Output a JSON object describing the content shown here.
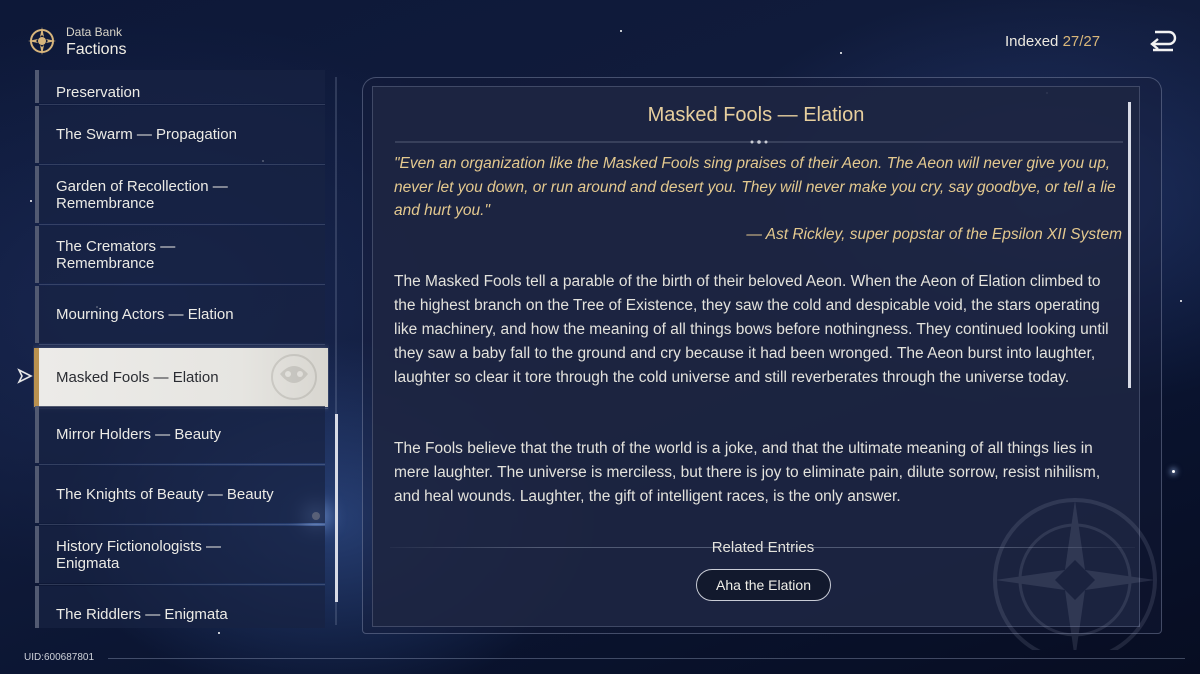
{
  "header": {
    "section": "Data Bank",
    "title": "Factions",
    "indexed_label": "Indexed",
    "indexed_count": "27/27"
  },
  "sidebar": {
    "items": [
      {
        "label": "Preservation",
        "selected": false
      },
      {
        "label": "The Swarm — Propagation",
        "selected": false
      },
      {
        "label": "Garden of Recollection — Remembrance",
        "selected": false
      },
      {
        "label": "The Cremators — Remembrance",
        "selected": false
      },
      {
        "label": "Mourning Actors — Elation",
        "selected": false
      },
      {
        "label": "Masked Fools — Elation",
        "selected": true
      },
      {
        "label": "Mirror Holders — Beauty",
        "selected": false
      },
      {
        "label": "The Knights of Beauty — Beauty",
        "selected": false
      },
      {
        "label": "History Fictionologists — Enigmata",
        "selected": false
      },
      {
        "label": "The Riddlers — Enigmata",
        "selected": false
      }
    ]
  },
  "entry": {
    "title": "Masked Fools — Elation",
    "quote": "\"Even an organization like the Masked Fools sing praises of their Aeon. The Aeon will never give you up, never let you down, or run around and desert you. They will never make you cry, say goodbye, or tell a lie and hurt you.\"",
    "attribution": "— Ast Rickley, super popstar of the Epsilon XII System",
    "paragraphs": [
      "The Masked Fools tell a parable of the birth of their beloved Aeon. When the Aeon of Elation climbed to the highest branch on the Tree of Existence, they saw the cold and despicable void, the stars operating like machinery, and how the meaning of all things bows before nothingness. They continued looking until they saw a baby fall to the ground and cry because it had been wronged. The Aeon burst into laughter, laughter so clear it tore through the cold universe and still reverberates through the universe today.",
      "The Fools believe that the truth of the world is a joke, and that the ultimate meaning of all things lies in mere laughter. The universe is merciless, but there is joy to eliminate pain, dilute sorrow, resist nihilism, and heal wounds. Laughter, the gift of intelligent races, is the only answer."
    ],
    "related_heading": "Related Entries",
    "related_entries": [
      "Aha the Elation"
    ]
  },
  "footer": {
    "uid": "UID:600687801"
  },
  "colors": {
    "accent_gold": "#e4c98f",
    "selected_bg": "#ecebe8",
    "selected_marker": "#b9914f"
  },
  "icons": {
    "logo": "compass-emblem-icon",
    "back": "return-arrow-icon",
    "pointer": "cursor-arrow-icon"
  }
}
